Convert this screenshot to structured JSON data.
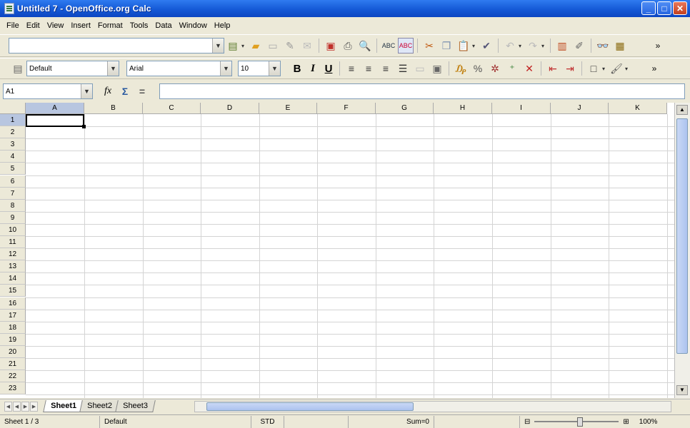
{
  "window": {
    "title": "Untitled 7 - OpenOffice.org Calc",
    "minimize": "_",
    "maximize": "□",
    "close": "✕"
  },
  "menu": [
    "File",
    "Edit",
    "View",
    "Insert",
    "Format",
    "Tools",
    "Data",
    "Window",
    "Help"
  ],
  "toolbar_standard": {
    "url_value": "",
    "more": "»"
  },
  "toolbar_format": {
    "style_value": "Default",
    "font_value": "Arial",
    "size_value": "10",
    "bold": "B",
    "italic": "I",
    "underline": "U",
    "more": "»"
  },
  "formula_bar": {
    "name_box": "A1",
    "function_wizard": "fx",
    "sum": "Σ",
    "equals": "=",
    "formula_value": ""
  },
  "grid": {
    "columns": [
      "A",
      "B",
      "C",
      "D",
      "E",
      "F",
      "G",
      "H",
      "I",
      "J",
      "K"
    ],
    "rows": [
      "1",
      "2",
      "3",
      "4",
      "5",
      "6",
      "7",
      "8",
      "9",
      "10",
      "11",
      "12",
      "13",
      "14",
      "15",
      "16",
      "17",
      "18",
      "19",
      "20",
      "21",
      "22",
      "23"
    ],
    "active_cell": "A1"
  },
  "sheet_tabs": [
    "Sheet1",
    "Sheet2",
    "Sheet3"
  ],
  "status": {
    "sheet": "Sheet 1 / 3",
    "style": "Default",
    "mode": "STD",
    "sum": "Sum=0",
    "zoom": "100%"
  },
  "colors": {
    "title_bar": "#1559d6",
    "window_bg": "#ece9d8",
    "header_active": "#b8c6e0"
  }
}
